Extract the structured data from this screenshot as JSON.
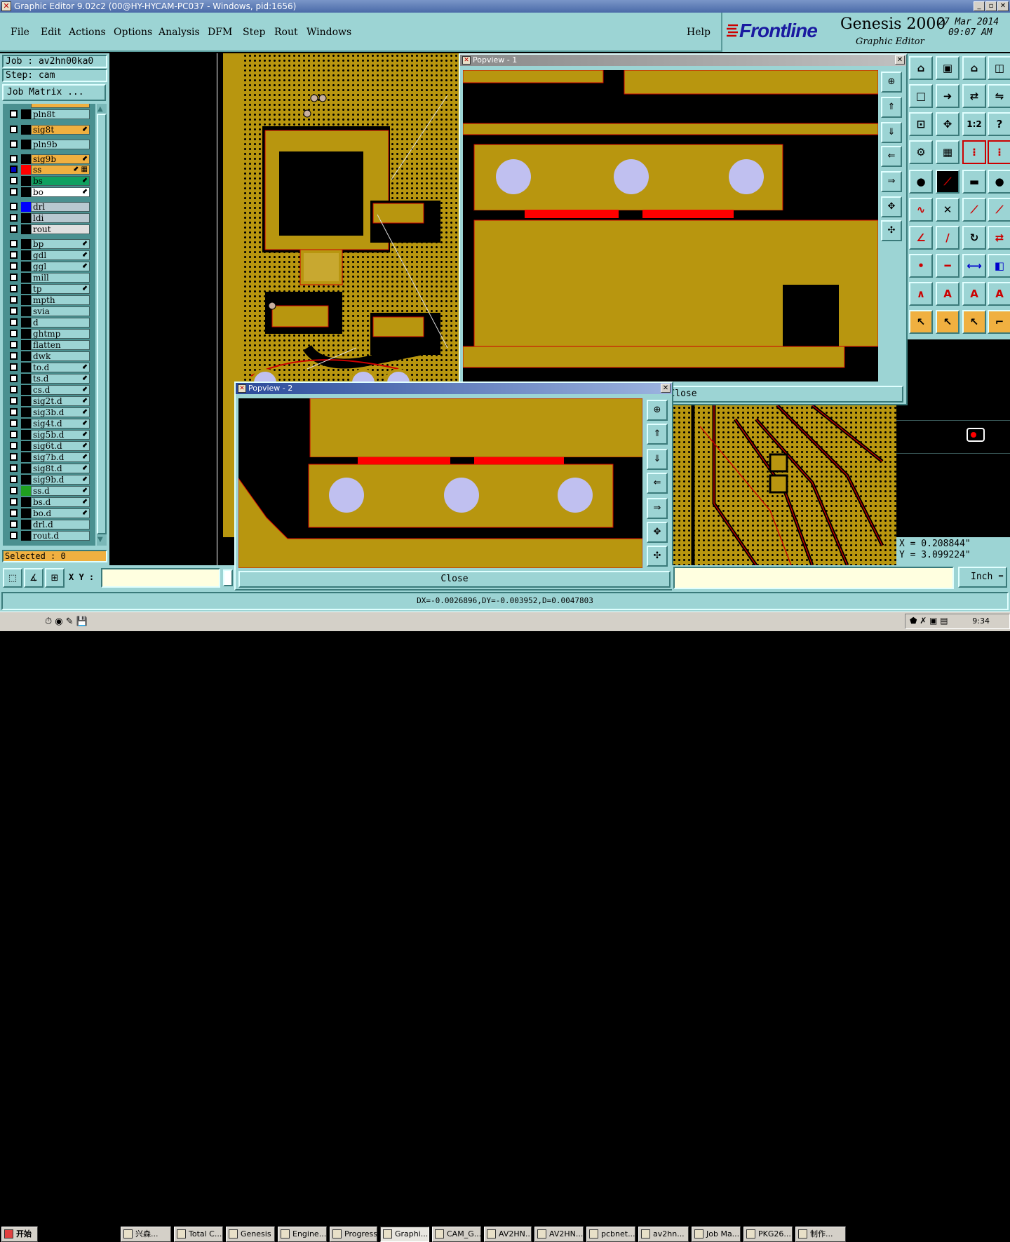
{
  "window": {
    "title": "Graphic Editor 9.02c2 (00@HY-HYCAM-PC037 - Windows, pid:1656)"
  },
  "menu": [
    "File",
    "Edit",
    "Actions",
    "Options",
    "Analysis",
    "DFM",
    "Step",
    "Rout",
    "Windows"
  ],
  "help_label": "Help",
  "brand": {
    "logo": "Frontline",
    "product": "Genesis 2000",
    "subtitle": "Graphic Editor",
    "date": "27 Mar 2014",
    "time": "09:07 AM"
  },
  "job": {
    "job": "Job : av2hn00ka0",
    "step": "Step: cam",
    "matrix": "Job Matrix ..."
  },
  "layers": [
    {
      "name": "pln8t",
      "bg": "#9cd4d4",
      "color": "#000000",
      "mark": ""
    },
    {
      "name": "sig8t",
      "bg": "#f0b040",
      "color": "#000000",
      "mark": "⬋"
    },
    {
      "name": "pln9b",
      "bg": "#9cd4d4",
      "color": "#000000",
      "mark": ""
    },
    {
      "name": "sig9b",
      "bg": "#f0b040",
      "color": "#000000",
      "mark": "⬋"
    },
    {
      "name": "ss",
      "bg": "#f0b040",
      "color": "#ff0000",
      "mark": "⬋ ▦",
      "active": true
    },
    {
      "name": "bs",
      "bg": "#10a060",
      "color": "#000000",
      "mark": "⬋"
    },
    {
      "name": "bo",
      "bg": "#ffffff",
      "color": "#000000",
      "mark": "⬋"
    },
    {
      "name": "drl",
      "bg": "#b8c8d0",
      "color": "#0000ff",
      "mark": ""
    },
    {
      "name": "ldi",
      "bg": "#b8c8d0",
      "color": "#000000",
      "mark": ""
    },
    {
      "name": "rout",
      "bg": "#e0e0e0",
      "color": "#000000",
      "mark": ""
    },
    {
      "name": "bp",
      "bg": "#9cd4d4",
      "color": "#000000",
      "mark": "⬋"
    },
    {
      "name": "gdl",
      "bg": "#9cd4d4",
      "color": "#000000",
      "mark": "⬋"
    },
    {
      "name": "ggl",
      "bg": "#9cd4d4",
      "color": "#000000",
      "mark": "⬋"
    },
    {
      "name": "mill",
      "bg": "#9cd4d4",
      "color": "#000000",
      "mark": ""
    },
    {
      "name": "tp",
      "bg": "#9cd4d4",
      "color": "#000000",
      "mark": "⬋"
    },
    {
      "name": "mpth",
      "bg": "#9cd4d4",
      "color": "#000000",
      "mark": ""
    },
    {
      "name": "svia",
      "bg": "#9cd4d4",
      "color": "#000000",
      "mark": ""
    },
    {
      "name": "d",
      "bg": "#9cd4d4",
      "color": "#000000",
      "mark": ""
    },
    {
      "name": "ghtmp",
      "bg": "#9cd4d4",
      "color": "#000000",
      "mark": ""
    },
    {
      "name": "flatten",
      "bg": "#9cd4d4",
      "color": "#000000",
      "mark": ""
    },
    {
      "name": "dwk",
      "bg": "#9cd4d4",
      "color": "#000000",
      "mark": ""
    },
    {
      "name": "to.d",
      "bg": "#9cd4d4",
      "color": "#000000",
      "mark": "⬋"
    },
    {
      "name": "ts.d",
      "bg": "#9cd4d4",
      "color": "#000000",
      "mark": "⬋"
    },
    {
      "name": "cs.d",
      "bg": "#9cd4d4",
      "color": "#000000",
      "mark": "⬋"
    },
    {
      "name": "sig2t.d",
      "bg": "#9cd4d4",
      "color": "#000000",
      "mark": "⬋"
    },
    {
      "name": "sig3b.d",
      "bg": "#9cd4d4",
      "color": "#000000",
      "mark": "⬋"
    },
    {
      "name": "sig4t.d",
      "bg": "#9cd4d4",
      "color": "#000000",
      "mark": "⬋"
    },
    {
      "name": "sig5b.d",
      "bg": "#9cd4d4",
      "color": "#000000",
      "mark": "⬋"
    },
    {
      "name": "sig6t.d",
      "bg": "#9cd4d4",
      "color": "#000000",
      "mark": "⬋"
    },
    {
      "name": "sig7b.d",
      "bg": "#9cd4d4",
      "color": "#000000",
      "mark": "⬋"
    },
    {
      "name": "sig8t.d",
      "bg": "#9cd4d4",
      "color": "#000000",
      "mark": "⬋"
    },
    {
      "name": "sig9b.d",
      "bg": "#9cd4d4",
      "color": "#000000",
      "mark": "⬋"
    },
    {
      "name": "ss.d",
      "bg": "#9cd4d4",
      "color": "#20a020",
      "mark": "⬋"
    },
    {
      "name": "bs.d",
      "bg": "#9cd4d4",
      "color": "#000000",
      "mark": "⬋"
    },
    {
      "name": "bo.d",
      "bg": "#9cd4d4",
      "color": "#000000",
      "mark": "⬋"
    },
    {
      "name": "drl.d",
      "bg": "#9cd4d4",
      "color": "#000000",
      "mark": ""
    },
    {
      "name": "rout.d",
      "bg": "#9cd4d4",
      "color": "#000000",
      "mark": ""
    }
  ],
  "selected": "Selected : 0",
  "xy_label": "X Y :",
  "xy_value": "",
  "units": "Inch",
  "coords": {
    "x": "X = 0.208844\"",
    "y": "Y = 3.099224\""
  },
  "status": "DX=-0.0026896,DY=-0.003952,D=0.0047803",
  "popview1": {
    "title": "Popview - 1",
    "close": "Close"
  },
  "popview2": {
    "title": "Popview - 2",
    "close": "Close"
  },
  "taskbar": {
    "start": "开始",
    "items": [
      "兴森...",
      "Total C...",
      "Genesis",
      "Engine...",
      "Progress",
      "Graphi...",
      "CAM_G...",
      "AV2HN...",
      "AV2HN...",
      "pcbnet...",
      "av2hn...",
      "Job Ma...",
      "PKG26...",
      "制作..."
    ],
    "clock": "9:34"
  },
  "colors": {
    "copper": "#b8960f",
    "highlight": "#ff0000",
    "panel": "#9cd4d4",
    "pad": "#c0c0f0"
  }
}
